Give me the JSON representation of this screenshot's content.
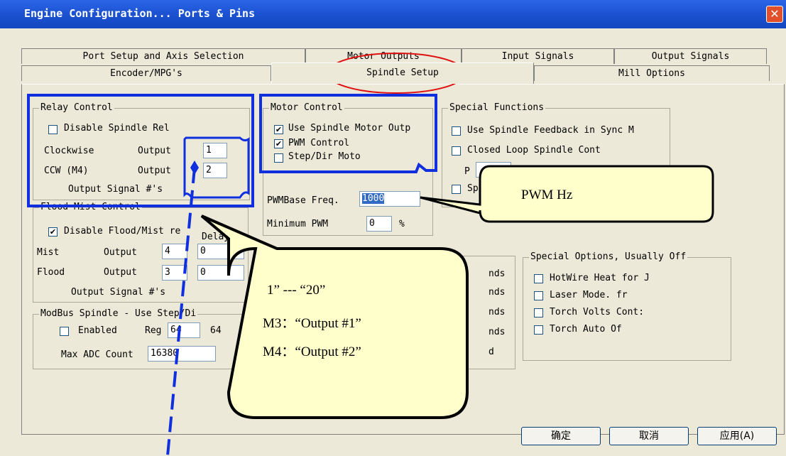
{
  "window": {
    "title": "Engine Configuration... Ports & Pins",
    "close_glyph": "✕"
  },
  "tabs_row1": [
    "Port Setup and Axis Selection",
    "Motor Outputs",
    "Input Signals",
    "Output Signals"
  ],
  "tabs_row2": [
    "Encoder/MPG's",
    "Spindle Setup",
    "Mill Options"
  ],
  "relay": {
    "legend": "Relay Control",
    "disable": "Disable Spindle Rel",
    "cw_label": "Clockwise",
    "cw_output": "Output",
    "cw_value": "1",
    "ccw_label": "CCW (M4)",
    "ccw_output": "Output",
    "ccw_value": "2",
    "signal": "Output Signal #'s"
  },
  "flood": {
    "legend": "Flood Mist Control",
    "disable": "Disable Flood/Mist re",
    "delay": "Delay",
    "mist_label": "Mist",
    "mist_output": "Output",
    "mist_value": "4",
    "mist_delay": "0",
    "flood_label": "Flood",
    "flood_output": "Output",
    "flood_value": "3",
    "flood_delay": "0",
    "signal": "Output Signal #'s"
  },
  "modbus": {
    "legend": "ModBus Spindle - Use Step/Di",
    "enabled": "Enabled",
    "reg_label": "Reg",
    "reg_value": "64",
    "reg_value2": "64",
    "max_label": "Max ADC Count",
    "max_value": "16380"
  },
  "motor": {
    "legend": "Motor Control",
    "use": "Use Spindle Motor Outp",
    "pwm": "PWM Control",
    "step": "Step/Dir Moto",
    "pwm_freq_label": "PWMBase Freq.",
    "pwm_freq_value": "1000",
    "min_pwm_label": "Minimum PWM",
    "min_pwm_value": "0",
    "min_pwm_unit": "%"
  },
  "special": {
    "legend": "Special Functions",
    "feedback": "Use Spindle Feedback in Sync M",
    "closed": "Closed Loop Spindle Cont",
    "p_label": "P",
    "sp_partial": "Sp"
  },
  "partial_list": [
    "nds",
    "nds",
    "nds",
    "nds",
    "d"
  ],
  "special_opts": {
    "legend": "Special Options, Usually Off",
    "items": [
      "HotWire Heat for J",
      "Laser Mode. fr",
      "Torch Volts Cont:",
      "Torch Auto Of"
    ]
  },
  "buttons": {
    "ok": "确定",
    "cancel": "取消",
    "apply": "应用(A)"
  },
  "callout_pwm": {
    "text": "PWM  Hz"
  },
  "callout_note": {
    "line1": "1” --- “20”",
    "line2": "M3：“Output #1”",
    "line3": "M4：“Output #2”"
  }
}
